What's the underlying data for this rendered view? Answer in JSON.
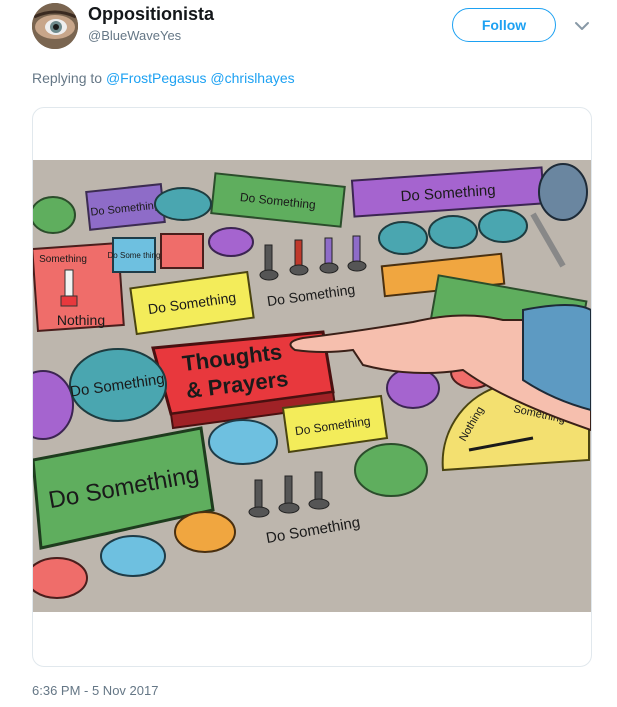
{
  "tweet": {
    "display_name": "Oppositionista",
    "handle": "@BlueWaveYes",
    "follow_label": "Follow",
    "replying_prefix": "Replying to",
    "reply_to": [
      "@FrostPegasus",
      "@chrislhayes"
    ],
    "timestamp": "6:36 PM - 5 Nov 2017"
  },
  "image": {
    "center_label_line1": "Thoughts",
    "center_label_line2": "& Prayers",
    "button_label": "Do Something",
    "small_label": "Do Some thing",
    "left_label_top": "Something",
    "left_label_bottom": "Nothing",
    "gauge_left": "Nothing",
    "gauge_right": "Something"
  },
  "colors": {
    "accent": "#1da1f2",
    "secondary_text": "#657786",
    "red_button": "#e8383d",
    "green": "#5cae5a",
    "yellow": "#f3ec5a",
    "purple": "#9b59d0",
    "teal": "#4aa6a4",
    "panel": "#b8b3ac"
  },
  "icons": [
    "chevron-down-icon"
  ]
}
